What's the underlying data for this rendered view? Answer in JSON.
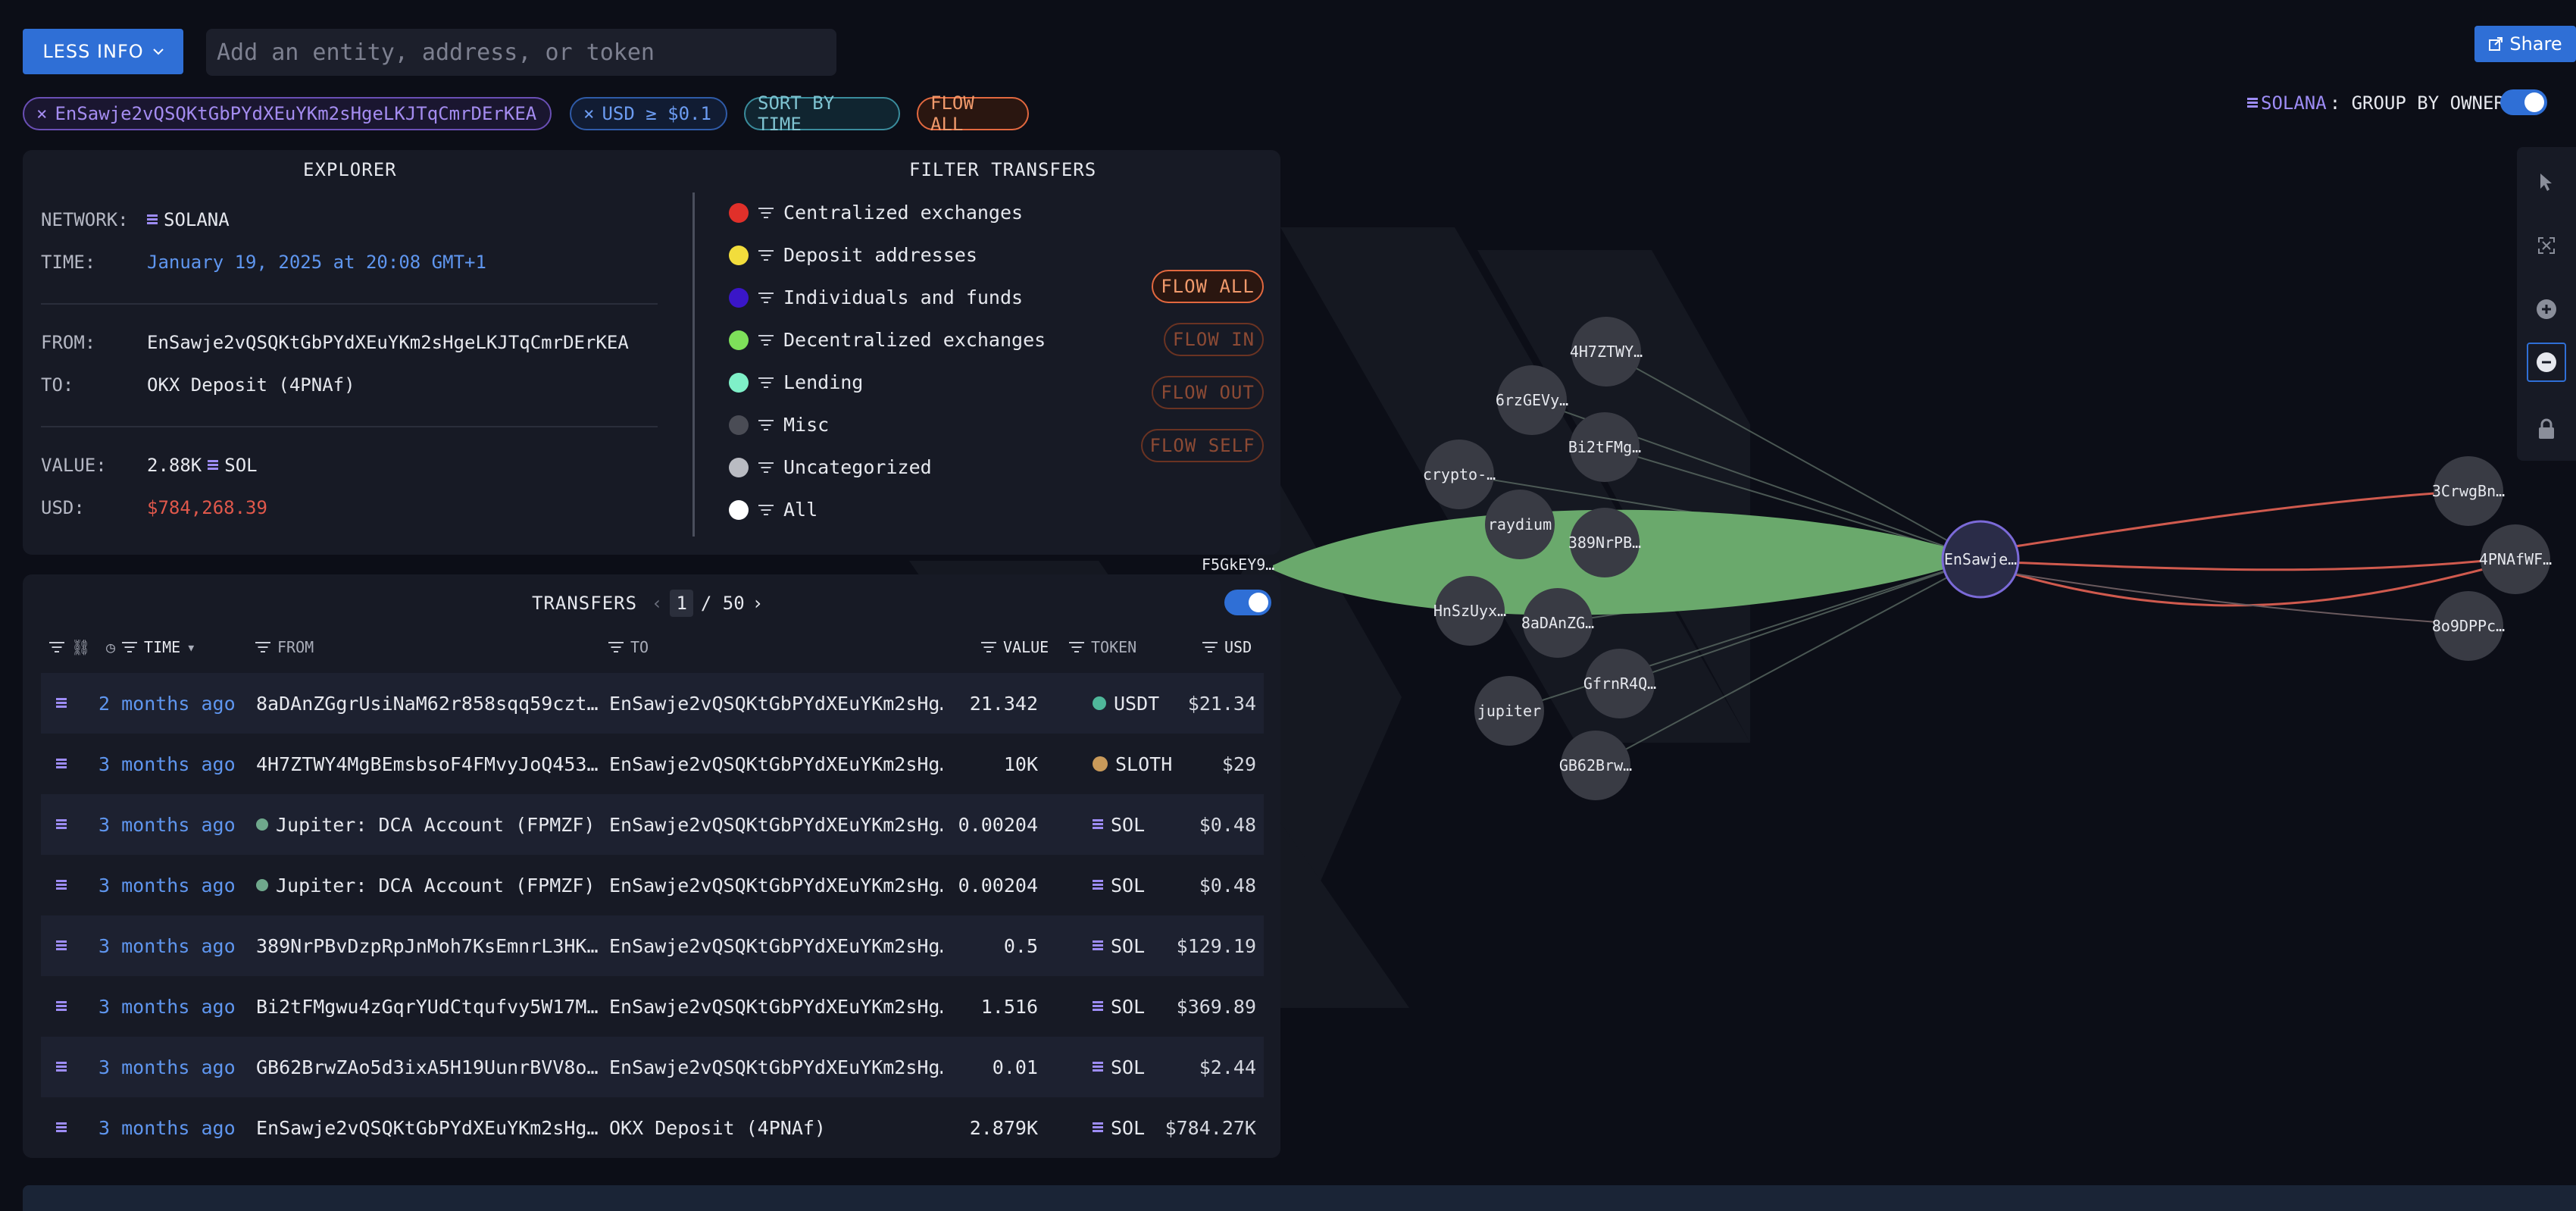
{
  "topbar": {
    "less_info_label": "LESS INFO",
    "search_placeholder": "Add an entity, address, or token",
    "share_label": "Share"
  },
  "chips": {
    "address": "EnSawje2vQSQKtGbPYdXEuYKm2sHgeLKJTqCmrDErKEA",
    "usd_filter": "USD ≥ $0.1",
    "sort": "SORT BY TIME",
    "flow": "FLOW ALL"
  },
  "group_by": {
    "network": "SOLANA",
    "label": ": GROUP BY OWNER",
    "enabled": true
  },
  "explorer": {
    "heading": "EXPLORER",
    "network_label": "NETWORK:",
    "network_value": "SOLANA",
    "time_label": "TIME:",
    "time_value": "January 19, 2025 at 20:08 GMT+1",
    "from_label": "FROM:",
    "from_value": "EnSawje2vQSQKtGbPYdXEuYKm2sHgeLKJTqCmrDErKEA",
    "to_label": "TO:",
    "to_value": "OKX Deposit (4PNAf)",
    "value_label": "VALUE:",
    "value_amount": "2.88K",
    "value_token": "SOL",
    "usd_label": "USD:",
    "usd_value": "$784,268.39"
  },
  "filter_transfers": {
    "heading": "FILTER TRANSFERS",
    "items": [
      {
        "label": "Centralized exchanges",
        "color": "#e0302a"
      },
      {
        "label": "Deposit addresses",
        "color": "#f2dd3c"
      },
      {
        "label": "Individuals and funds",
        "color": "#3a16c8"
      },
      {
        "label": "Decentralized exchanges",
        "color": "#7ee05a"
      },
      {
        "label": "Lending",
        "color": "#7ff0c8"
      },
      {
        "label": "Misc",
        "color": "#4a4c55"
      },
      {
        "label": "Uncategorized",
        "color": "#b9bbc2"
      },
      {
        "label": "All",
        "color": "#ffffff"
      }
    ],
    "flow_buttons": [
      "FLOW ALL",
      "FLOW IN",
      "FLOW OUT",
      "FLOW SELF"
    ]
  },
  "transfers": {
    "heading": "TRANSFERS",
    "page_current": "1",
    "page_total": "/ 50",
    "columns": {
      "time": "TIME",
      "from": "FROM",
      "to": "TO",
      "value": "VALUE",
      "token": "TOKEN",
      "usd": "USD"
    },
    "rows": [
      {
        "time": "2 months ago",
        "from": "8aDAnZGgrUsiNaM62r858sqq59czt…",
        "to": "EnSawje2vQSQKtGbPYdXEuYKm2sHg…",
        "value": "21.342",
        "token": "USDT",
        "token_icon": "usdt-icon",
        "usd": "$21.34"
      },
      {
        "time": "3 months ago",
        "from": "4H7ZTWY4MgBEmsbsoF4FMvyJoQ453…",
        "to": "EnSawje2vQSQKtGbPYdXEuYKm2sHg…",
        "value": "10K",
        "token": "SLOTH",
        "token_icon": "sloth-icon",
        "usd": "$29"
      },
      {
        "time": "3 months ago",
        "from": "Jupiter: DCA Account (FPMZF)",
        "to": "EnSawje2vQSQKtGbPYdXEuYKm2sHg…",
        "value": "0.00204",
        "token": "SOL",
        "token_icon": "sol-icon",
        "usd": "$0.48"
      },
      {
        "time": "3 months ago",
        "from": "Jupiter: DCA Account (FPMZF)",
        "to": "EnSawje2vQSQKtGbPYdXEuYKm2sHg…",
        "value": "0.00204",
        "token": "SOL",
        "token_icon": "sol-icon",
        "usd": "$0.48"
      },
      {
        "time": "3 months ago",
        "from": "389NrPBvDzpRpJnMoh7KsEmnrL3HK…",
        "to": "EnSawje2vQSQKtGbPYdXEuYKm2sHg…",
        "value": "0.5",
        "token": "SOL",
        "token_icon": "sol-icon",
        "usd": "$129.19"
      },
      {
        "time": "3 months ago",
        "from": "Bi2tFMgwu4zGqrYUdCtqufvy5W17M…",
        "to": "EnSawje2vQSQKtGbPYdXEuYKm2sHg…",
        "value": "1.516",
        "token": "SOL",
        "token_icon": "sol-icon",
        "usd": "$369.89"
      },
      {
        "time": "3 months ago",
        "from": "GB62BrwZAo5d3ixA5H19UunrBVV8o…",
        "to": "EnSawje2vQSQKtGbPYdXEuYKm2sHg…",
        "value": "0.01",
        "token": "SOL",
        "token_icon": "sol-icon",
        "usd": "$2.44"
      },
      {
        "time": "3 months ago",
        "from": "EnSawje2vQSQKtGbPYdXEuYKm2sHg…",
        "to": "OKX Deposit (4PNAf)",
        "value": "2.879K",
        "token": "SOL",
        "token_icon": "sol-icon",
        "usd": "$784.27K"
      }
    ]
  },
  "graph": {
    "nodes": [
      {
        "label": "4H7ZTWY…"
      },
      {
        "label": "6rzGEVy…"
      },
      {
        "label": "Bi2tFMg…"
      },
      {
        "label": "crypto-…"
      },
      {
        "label": "raydium"
      },
      {
        "label": "389NrPB…"
      },
      {
        "label": "HnSzUyx…"
      },
      {
        "label": "8aDAnZG…"
      },
      {
        "label": "GfrnR4Q…"
      },
      {
        "label": "jupiter"
      },
      {
        "label": "GB62Brw…"
      },
      {
        "label": "EnSawje…"
      },
      {
        "label": "3CrwgBn…"
      },
      {
        "label": "4PNAfWF…"
      },
      {
        "label": "8o9DPPc…"
      }
    ],
    "source_label": "F5GkEY9…",
    "colors": {
      "flow_fill": "#6aa96c",
      "outflow": "#d05a4e",
      "node": "#393b44",
      "focus_ring": "#7b6ad8"
    }
  },
  "toolbar": {
    "tools": [
      "cursor-icon",
      "fit-screen-icon",
      "zoom-in-icon",
      "zoom-out-icon",
      "lock-icon"
    ]
  }
}
